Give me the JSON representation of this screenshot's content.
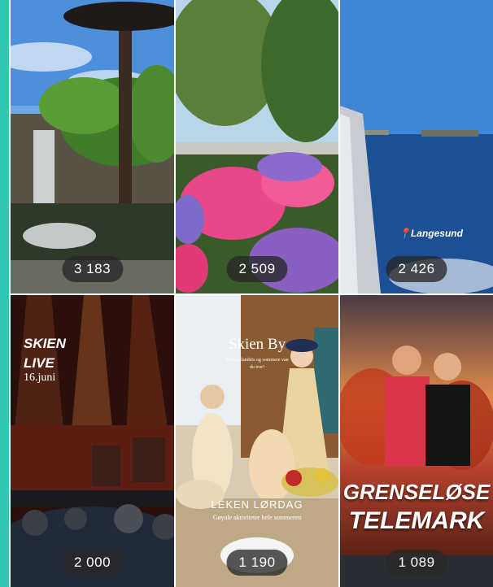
{
  "tiles": [
    {
      "count": "3 183",
      "caption": ""
    },
    {
      "count": "2 509",
      "caption": ""
    },
    {
      "count": "2 426",
      "caption": "Langesund"
    },
    {
      "count": "2 000",
      "caption_line1": "SKIEN",
      "caption_line2": "LIVE",
      "caption_line3": "16.juni"
    },
    {
      "count": "1 190",
      "title": "Skien By",
      "subtitle": "Leken lørdag",
      "subtitle2": "Gøyale aktiviteter hele sommeren",
      "small": "Eventyrlandets og sommere van du tror!"
    },
    {
      "count": "1 089",
      "line1": "GRENSELØSE",
      "line2": "TELEMARK"
    }
  ],
  "colors": {
    "accent_edge": "#2ec9b0",
    "badge_bg": "#282828"
  }
}
